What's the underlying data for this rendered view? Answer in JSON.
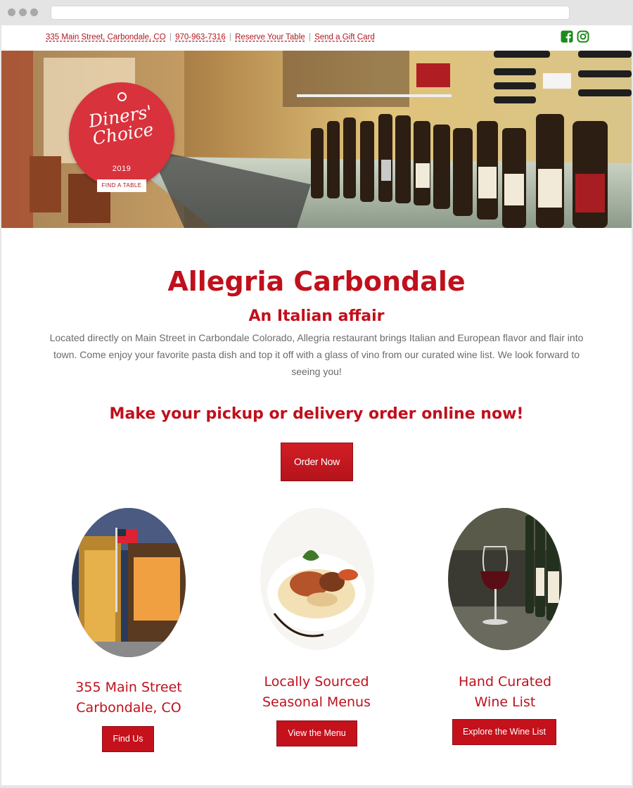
{
  "topbar": {
    "address": "335 Main Street, Carbondale, CO",
    "phone": "970-963-7316",
    "reserve": "Reserve Your Table",
    "gift": "Send a Gift Card",
    "separator": "|",
    "social_icons": [
      "facebook-square-icon",
      "instagram-icon"
    ],
    "social_color": "#1e8a1e"
  },
  "hero": {
    "badge_title_line1": "Diners'",
    "badge_title_line2": "Choice",
    "badge_year": "2019",
    "badge_button": "FIND A TABLE",
    "badge_color": "#d8323c"
  },
  "main": {
    "title": "Allegria Carbondale",
    "subtitle": "An Italian affair",
    "description": "Located directly on Main Street in Carbondale Colorado, Allegria restaurant brings Italian and European flavor and flair into town. Come enjoy your favorite pasta dish and top it off with a glass of vino from our curated wine list. We look forward to seeing you!",
    "cta_heading": "Make your pickup or delivery order online now!",
    "order_button": "Order Now",
    "accent_color": "#c0101c"
  },
  "features": [
    {
      "title_line1": "355 Main Street",
      "title_line2": "Carbondale, CO",
      "button": "Find Us"
    },
    {
      "title_line1": "Locally Sourced",
      "title_line2": "Seasonal Menus",
      "button": "View the Menu"
    },
    {
      "title_line1": "Hand Curated",
      "title_line2": "Wine List",
      "button": "Explore the Wine List"
    }
  ]
}
